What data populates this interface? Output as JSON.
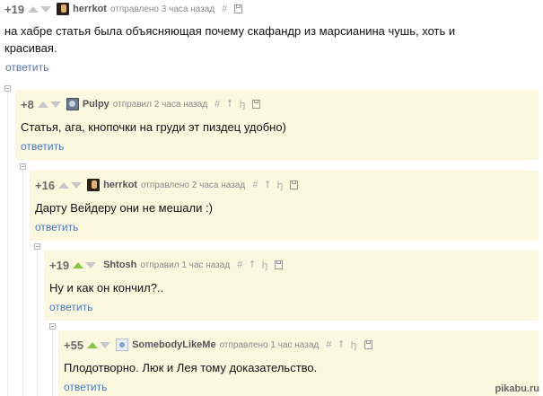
{
  "comments": [
    {
      "score": "+19",
      "username": "herrkot",
      "meta": "отправлено 3 часа назад",
      "text": "на хабре статья была объясняющая почему скафандр из марсианина чушь, хоть и красивая.",
      "reply": "ответить",
      "icons": [
        "hash-icon",
        "save-icon"
      ]
    },
    {
      "score": "+8",
      "username": "Pulpy",
      "meta": "отправил 2 часа назад",
      "text": "Статья, ага, кнопочки на груди эт пиздец удобно)",
      "reply": "ответить",
      "icons": [
        "hash-icon",
        "parent-arrow-icon",
        "thread-icon",
        "save-icon"
      ]
    },
    {
      "score": "+16",
      "username": "herrkot",
      "meta": "отправлено 2 часа назад",
      "text": "Дарту Вейдеру они не мешали :)",
      "reply": "ответить",
      "icons": [
        "hash-icon",
        "parent-arrow-icon",
        "thread-icon",
        "save-icon"
      ]
    },
    {
      "score": "+19",
      "username": "Shtosh",
      "meta": "отправил 1 час назад",
      "text": "Ну и как он кончил?..",
      "reply": "ответить",
      "icons": [
        "hash-icon",
        "parent-arrow-icon",
        "thread-icon",
        "save-icon"
      ]
    },
    {
      "score": "+55",
      "username": "SomebodyLikeMe",
      "meta": "отправлено 1 час назад",
      "text": "Плодотворно. Люк и Лея тому доказательство.",
      "reply": "ответить",
      "icons": [
        "hash-icon",
        "parent-arrow-icon",
        "thread-icon",
        "save-icon"
      ]
    }
  ],
  "glyphs": {
    "hash": "#",
    "parent": "⭡",
    "thread": "ꜧ"
  },
  "watermark": "pikabu.ru",
  "colors": {
    "reply_bg": "#fcf8e0",
    "link": "#4a77b6",
    "upvote_active": "#8bc34a"
  }
}
